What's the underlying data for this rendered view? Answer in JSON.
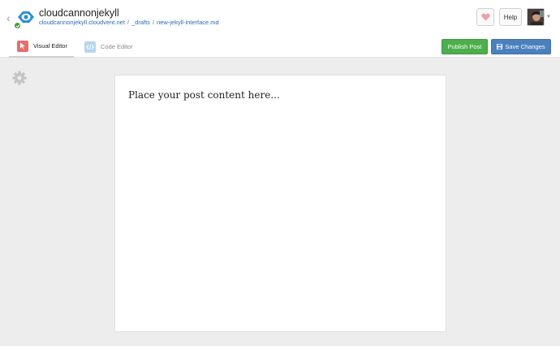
{
  "header": {
    "site_name": "cloudcannonjekyll",
    "breadcrumb": {
      "domain": "cloudcannonjekyll.cloudvent.net",
      "separator": "/",
      "folder": "_drafts",
      "file": "new-jekyll-interface.md"
    },
    "help_label": "Help",
    "icons": {
      "back": "chevron-left-icon",
      "logo": "cloudcannon-logo",
      "status": "check-icon",
      "heart": "heart-icon",
      "avatar_caret": "caret-down-icon"
    }
  },
  "tabs": [
    {
      "label": "Visual Editor",
      "icon": "cursor-icon",
      "active": true
    },
    {
      "label": "Code Editor",
      "icon": "code-icon",
      "active": false
    }
  ],
  "actions": {
    "publish_label": "Publish Post",
    "save_label": "Save Changes"
  },
  "editor": {
    "placeholder_text": "Place your post content here..."
  },
  "colors": {
    "publish": "#4cae4c",
    "save": "#4a80bd",
    "link": "#2a6ab5",
    "heart": "#f0a0a8",
    "status": "#4a9b3a"
  }
}
